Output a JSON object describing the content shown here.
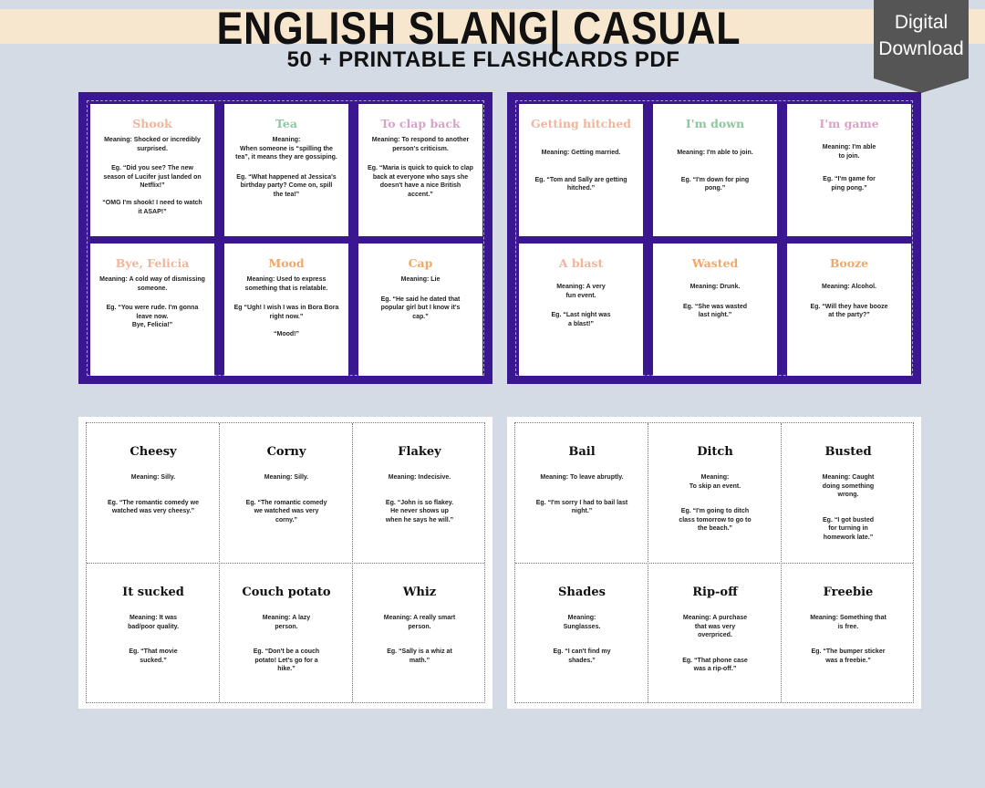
{
  "header": {
    "title": "ENGLISH SLANG| CASUAL",
    "subtitle": "50 + PRINTABLE FLASHCARDS PDF",
    "badge": "Digital\nDownload"
  },
  "colors": {
    "sheet_purple": "#3a1690",
    "banner": "#f8e7cf",
    "badge": "#555555",
    "background": "#d4dbe4"
  },
  "sheets": [
    {
      "cards": [
        {
          "term": "Shook",
          "color": "#f2b49a",
          "meaning": "Meaning: Shocked or incredibly\nsurprised.",
          "example": "Eg. “Did you see? The new\nseason of Lucifer just landed on\nNetflix!”\n\n“OMG I'm shook! I need to watch\nit ASAP!”"
        },
        {
          "term": "Tea",
          "color": "#8dc8a0",
          "meaning": "Meaning:\nWhen someone is “spilling the\ntea”, it means they are gossiping.",
          "example": "Eg. “What happened at Jessica's\nbirthday party? Come on, spill\nthe tea!”"
        },
        {
          "term": "To clap back",
          "color": "#d9a3c9",
          "meaning": "Meaning: To respond to another\nperson's criticism.",
          "example": "Eg. “Maria is quick to quick to clap\nback at everyone who says she\ndoesn't have a nice British\naccent.”"
        },
        {
          "term": "Bye, Felicia",
          "color": "#f2b49a",
          "meaning": "Meaning:  A cold way of dismissing\nsomeone.",
          "example": "Eg. “You were rude. I'm gonna\nleave now.\nBye, Felicia!”"
        },
        {
          "term": "Mood",
          "color": "#f0a86a",
          "meaning": "Meaning:  Used to express\nsomething that is relatable.",
          "example": "Eg “Ugh! I wish I was in Bora Bora\nright now.”\n\n“Mood!”"
        },
        {
          "term": "Cap",
          "color": "#f0a86a",
          "meaning": "Meaning:  Lie",
          "example": "Eg. “He said he dated that\npopular girl but I know it's\ncap.”"
        }
      ]
    },
    {
      "cards": [
        {
          "term": "Getting hitched",
          "color": "#f2b49a",
          "meaning": "Meaning: Getting married.",
          "example": "Eg. “Tom and Sally are getting\nhitched.”"
        },
        {
          "term": "I'm down",
          "color": "#8dc8a0",
          "meaning": "Meaning: I'm able to join.",
          "example": "Eg. “I'm down for ping\npong.”"
        },
        {
          "term": "I'm game",
          "color": "#d9a3c9",
          "meaning": "Meaning: I'm able\nto join.",
          "example": "Eg. “I'm game for\nping pong.”"
        },
        {
          "term": "A blast",
          "color": "#f2b49a",
          "meaning": "Meaning:  A very\nfun event.",
          "example": "Eg. “Last night was\na blast!”"
        },
        {
          "term": "Wasted",
          "color": "#f0a86a",
          "meaning": "Meaning: Drunk.",
          "example": "Eg. “She was wasted\nlast night.”"
        },
        {
          "term": "Booze",
          "color": "#f0a86a",
          "meaning": "Meaning:  Alcohol.",
          "example": "Eg. “Will they have booze\nat the party?”"
        }
      ]
    },
    {
      "cards": [
        {
          "term": "Cheesy",
          "meaning": "Meaning: Silly.",
          "example": "Eg. “The romantic comedy we\nwatched was very cheesy.”"
        },
        {
          "term": "Corny",
          "meaning": "Meaning: Silly.",
          "example": "Eg. “The romantic comedy\nwe watched was very\ncorny.”"
        },
        {
          "term": "Flakey",
          "meaning": "Meaning: Indecisive.",
          "example": "Eg. “John is so flakey.\nHe never shows up\nwhen he says he will.”"
        },
        {
          "term": "It sucked",
          "meaning": "Meaning:  It was\nbad/poor quality.",
          "example": "Eg. “That movie\nsucked.”"
        },
        {
          "term": "Couch potato",
          "meaning": "Meaning:  A lazy\nperson.",
          "example": "Eg. “Don't be a couch\npotato! Let's go for a\nhike.”"
        },
        {
          "term": "Whiz",
          "meaning": "Meaning:  A really smart\nperson.",
          "example": "Eg. “Sally is a whiz at\nmath.”"
        }
      ]
    },
    {
      "cards": [
        {
          "term": "Bail",
          "meaning": "Meaning: To leave abruptly.",
          "example": "Eg. “I'm sorry I had to bail last\nnight.”"
        },
        {
          "term": "Ditch",
          "meaning": "Meaning:\nTo skip an event.",
          "example": "Eg. “I'm going to ditch\nclass tomorrow to go to\nthe beach.”"
        },
        {
          "term": "Busted",
          "meaning": "Meaning: Caught\ndoing something\nwrong.",
          "example": "Eg. “I got busted\nfor turning in\nhomework late.”"
        },
        {
          "term": "Shades",
          "meaning": "Meaning:\nSunglasses.",
          "example": "Eg. “I can't find my\nshades.”"
        },
        {
          "term": "Rip-off",
          "meaning": "Meaning:  A purchase\nthat was very\noverpriced.",
          "example": "Eg. “That phone case\nwas a rip-off.”"
        },
        {
          "term": "Freebie",
          "meaning": "Meaning:  Something that\nis free.",
          "example": "Eg. “The bumper sticker\nwas a freebie.”"
        }
      ]
    }
  ]
}
